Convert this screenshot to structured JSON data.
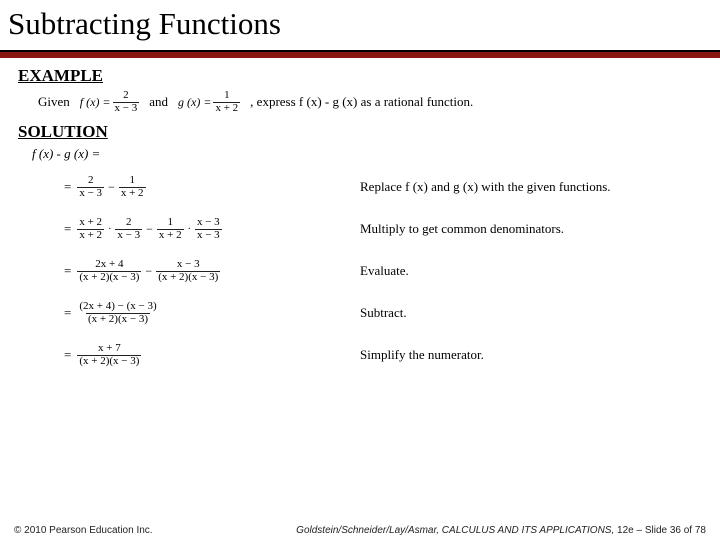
{
  "title": "Subtracting Functions",
  "headings": {
    "example": "EXAMPLE",
    "solution": "SOLUTION"
  },
  "prompt": {
    "given": "Given",
    "and": "and",
    "after": ", express f (x) - g (x) as a rational function.",
    "f_lhs": "f (x) =",
    "f_num": "2",
    "f_den": "x − 3",
    "g_lhs": "g (x) =",
    "g_num": "1",
    "g_den": "x + 2"
  },
  "result_lhs": "f (x) - g (x) =",
  "steps": [
    {
      "type": "sub2frac",
      "a_num": "2",
      "a_den": "x − 3",
      "b_num": "1",
      "b_den": "x + 2",
      "text": "Replace f (x) and g (x) with the given functions."
    },
    {
      "type": "mult2",
      "a1_num": "x + 2",
      "a1_den": "x + 2",
      "a2_num": "2",
      "a2_den": "x − 3",
      "b1_num": "1",
      "b1_den": "x + 2",
      "b2_num": "x − 3",
      "b2_den": "x − 3",
      "text": "Multiply to get common denominators."
    },
    {
      "type": "sub2frac",
      "a_num": "2x + 4",
      "a_den": "(x + 2)(x − 3)",
      "b_num": "x − 3",
      "b_den": "(x + 2)(x − 3)",
      "text": "Evaluate."
    },
    {
      "type": "single",
      "num": "(2x + 4) − (x − 3)",
      "den": "(x + 2)(x − 3)",
      "text": "Subtract."
    },
    {
      "type": "single",
      "num": "x + 7",
      "den": "(x + 2)(x − 3)",
      "text": "Simplify the numerator."
    }
  ],
  "footer": {
    "copyright": "© 2010 Pearson Education Inc.",
    "book": "Goldstein/Schneider/Lay/Asmar, CALCULUS AND ITS APPLICATIONS,",
    "edition": " 12e – Slide 36 of 78"
  }
}
